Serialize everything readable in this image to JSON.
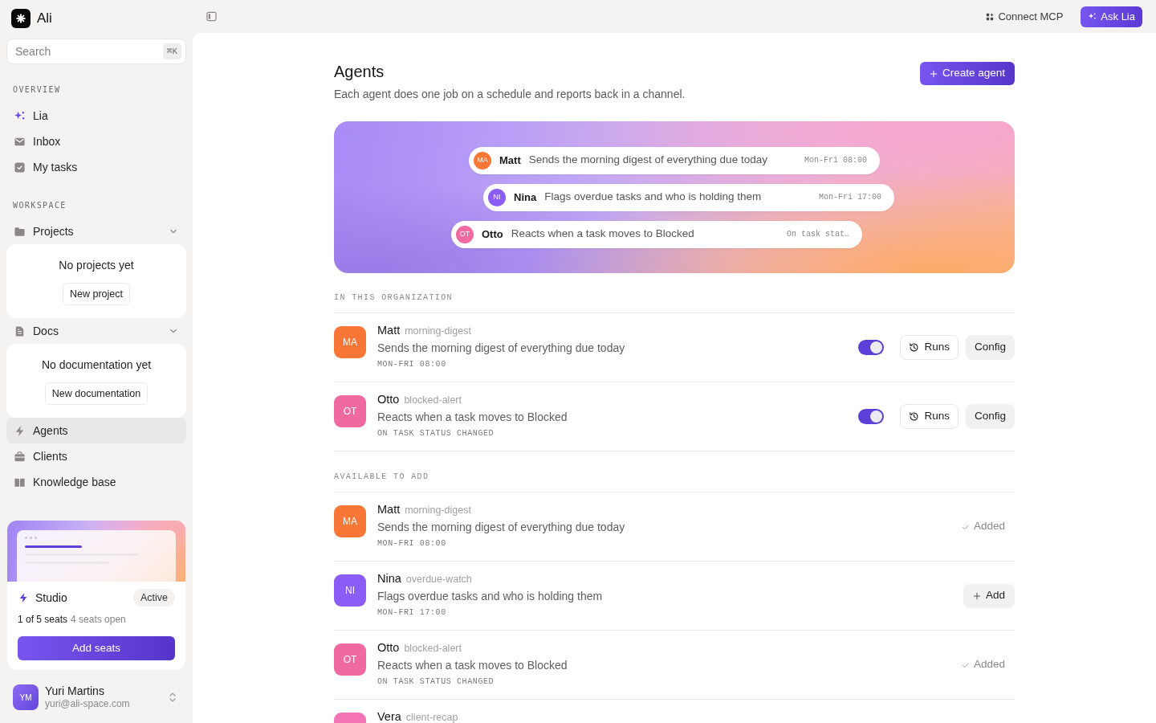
{
  "topbar": {
    "actions": [
      {
        "kind": "link",
        "label": "Connect MCP"
      },
      {
        "kind": "primary",
        "label": "Ask Lia"
      }
    ]
  },
  "sidebar": {
    "brand": "Ali",
    "search": {
      "placeholder": "Search",
      "shortcut": "⌘K"
    },
    "sections": [
      {
        "label": "OVERVIEW",
        "items": [
          {
            "kind": "link",
            "label": "Lia",
            "selected": false
          },
          {
            "kind": "link",
            "label": "Inbox",
            "selected": false
          },
          {
            "kind": "link",
            "label": "My tasks",
            "selected": false
          }
        ]
      },
      {
        "label": "WORKSPACE",
        "items": [
          {
            "kind": "group",
            "label": "Projects",
            "selected": false,
            "expanded": true,
            "empty_text": "No projects yet",
            "empty_action": "New project"
          },
          {
            "kind": "group",
            "label": "Docs",
            "selected": false,
            "expanded": true,
            "empty_text": "No documentation yet",
            "empty_action": "New documentation"
          },
          {
            "kind": "link",
            "label": "Agents",
            "selected": true
          },
          {
            "kind": "link",
            "label": "Clients",
            "selected": false
          },
          {
            "kind": "link",
            "label": "Knowledge base",
            "selected": false
          }
        ]
      }
    ],
    "plan": {
      "name": "Studio",
      "badge": "Active",
      "seats_used": "1 of 5 seats",
      "seats_open": "4 seats open",
      "action": "Add seats"
    },
    "user": {
      "initials": "YM",
      "name": "Yuri Martins",
      "email": "yuri@ali-space.com"
    }
  },
  "page": {
    "title": "Agents",
    "subtitle": "Each agent does one job on a schedule and reports back in a channel.",
    "action": "Create agent"
  },
  "banner": {
    "pills": [
      {
        "initials": "MA",
        "color": "#f97736",
        "name": "Matt",
        "description": "Sends the morning digest of everything due today",
        "schedule": "Mon-Fri 08:00"
      },
      {
        "initials": "NI",
        "color": "#8b5cf6",
        "name": "Nina",
        "description": "Flags overdue tasks and who is holding them",
        "schedule": "Mon-Fri 17:00"
      },
      {
        "initials": "OT",
        "color": "#f0699f",
        "name": "Otto",
        "description": "Reacts when a task moves to Blocked",
        "schedule": "On task stat…"
      }
    ]
  },
  "sections": [
    {
      "label": "IN THIS ORGANIZATION",
      "agents": [
        {
          "kind": "installed",
          "initials": "MA",
          "color": "#f97736",
          "name": "Matt",
          "slug": "morning-digest",
          "description": "Sends the morning digest of everything due today",
          "schedule": "MON-FRI 08:00",
          "on": true,
          "actions": [
            {
              "kind": "outline",
              "label": "Runs"
            },
            {
              "kind": "secondary",
              "label": "Config"
            }
          ]
        },
        {
          "kind": "installed",
          "initials": "OT",
          "color": "#f0699f",
          "name": "Otto",
          "slug": "blocked-alert",
          "description": "Reacts when a task moves to Blocked",
          "schedule": "ON TASK STATUS CHANGED",
          "on": true,
          "actions": [
            {
              "kind": "outline",
              "label": "Runs"
            },
            {
              "kind": "secondary",
              "label": "Config"
            }
          ]
        }
      ]
    },
    {
      "label": "AVAILABLE TO ADD",
      "agents": [
        {
          "kind": "catalog",
          "initials": "MA",
          "color": "#f97736",
          "name": "Matt",
          "slug": "morning-digest",
          "description": "Sends the morning digest of everything due today",
          "schedule": "MON-FRI 08:00",
          "added": true,
          "action": "Added"
        },
        {
          "kind": "catalog",
          "initials": "NI",
          "color": "#8b5cf6",
          "name": "Nina",
          "slug": "overdue-watch",
          "description": "Flags overdue tasks and who is holding them",
          "schedule": "MON-FRI 17:00",
          "added": false,
          "action": "Add"
        },
        {
          "kind": "catalog",
          "initials": "OT",
          "color": "#f0699f",
          "name": "Otto",
          "slug": "blocked-alert",
          "description": "Reacts when a task moves to Blocked",
          "schedule": "ON TASK STATUS CHANGED",
          "added": true,
          "action": "Added"
        },
        {
          "kind": "catalog",
          "color": "#f472b6",
          "name": "Vera",
          "slug": "client-recap"
        }
      ]
    }
  ]
}
